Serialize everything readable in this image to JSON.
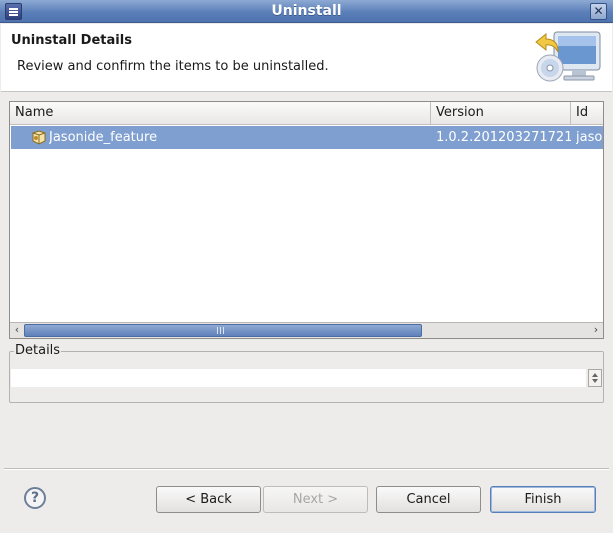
{
  "window": {
    "title": "Uninstall",
    "close_glyph": "✕"
  },
  "header": {
    "title": "Uninstall Details",
    "description": "Review and confirm the items to be uninstalled.",
    "icon": "uninstall-wizard-icon"
  },
  "table": {
    "columns": [
      "Name",
      "Version",
      "Id"
    ],
    "rows": [
      {
        "name": "Jasonide_feature",
        "version": "1.0.2.201203271721",
        "id": "jaso",
        "icon": "feature-icon",
        "selected": true
      }
    ]
  },
  "scrollbar": {
    "left_arrow": "‹",
    "right_arrow": "›",
    "grip": "III"
  },
  "details": {
    "label": "Details",
    "value": ""
  },
  "buttons": {
    "help": "?",
    "back": "< Back",
    "next": "Next >",
    "cancel": "Cancel",
    "finish": "Finish"
  },
  "colors": {
    "titlebar": "#5b7fb9",
    "selection": "#7e9fcf",
    "background": "#edeceb"
  }
}
